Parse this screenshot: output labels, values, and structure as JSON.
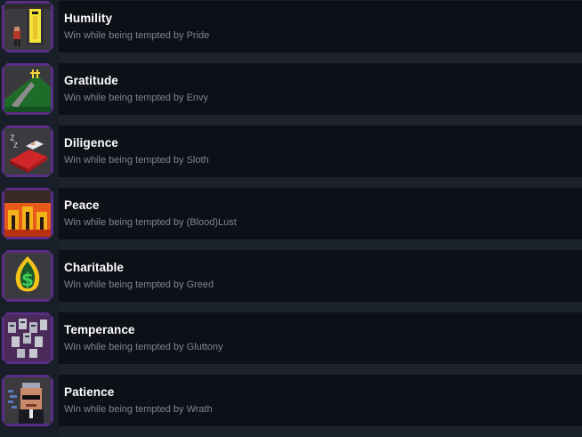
{
  "achievements": [
    {
      "title": "Humility",
      "description": "Win while being tempted by Pride",
      "icon": "elevator-icon"
    },
    {
      "title": "Gratitude",
      "description": "Win while being tempted by Envy",
      "icon": "hill-cross-icon"
    },
    {
      "title": "Diligence",
      "description": "Win while being tempted by Sloth",
      "icon": "sleeping-bed-icon"
    },
    {
      "title": "Peace",
      "description": "Win while being tempted by (Blood)Lust",
      "icon": "burning-city-icon"
    },
    {
      "title": "Charitable",
      "description": "Win while being tempted by Greed",
      "icon": "dollar-flame-icon"
    },
    {
      "title": "Temperance",
      "description": "Win while being tempted by Gluttony",
      "icon": "ghost-crowd-icon"
    },
    {
      "title": "Patience",
      "description": "Win while being tempted by Wrath",
      "icon": "angry-man-icon"
    }
  ],
  "colors": {
    "background": "#191f29",
    "row": "#0d1017",
    "icon_frame": "#5a2d86",
    "title": "#ffffff",
    "description": "#7e8693"
  }
}
